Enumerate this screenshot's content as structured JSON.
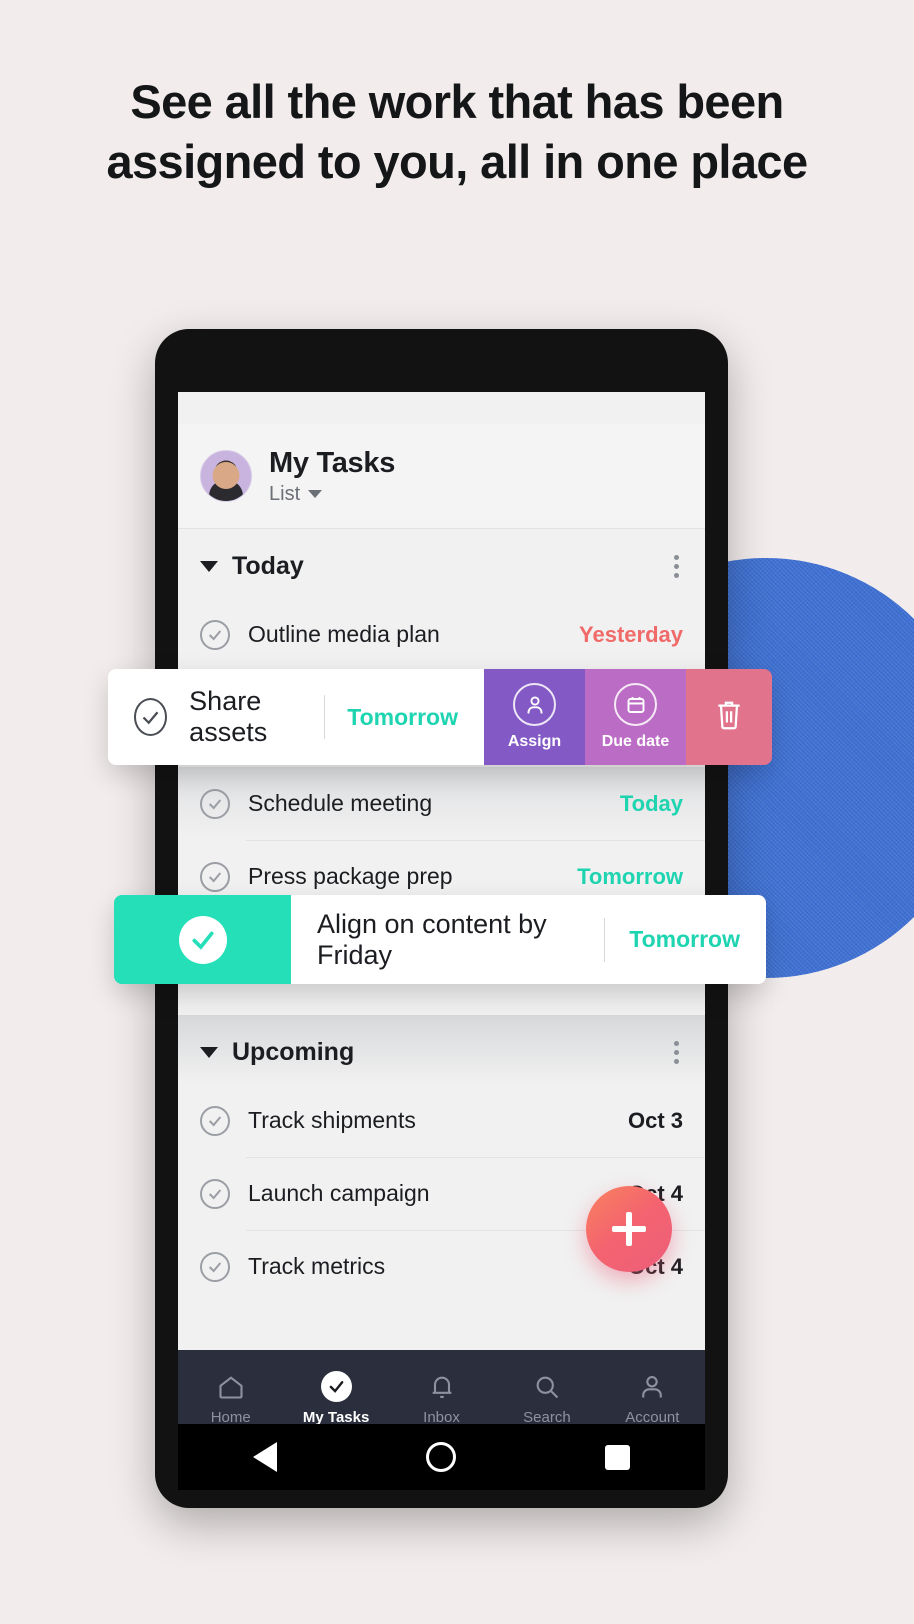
{
  "headline": {
    "line1": "See all the work that has been",
    "line2": "assigned to you, all in one place"
  },
  "colors": {
    "background": "#f2ecec",
    "blue_circle": "#3f71d4",
    "teal_accent": "#1fd4b0",
    "red_overdue": "#f06a6a",
    "fab": "#f4636f",
    "nav_bar": "#2b2f3d",
    "assign_action": "#8359c6",
    "duedate_action": "#bb6cc4",
    "delete_action": "#e1748c",
    "complete_swipe": "#24dfb7"
  },
  "phone": {
    "statusbar": {
      "icons": [
        "square-icon",
        "circle-icon",
        "triangle-down-icon"
      ]
    },
    "app_header": {
      "avatar": "user-avatar",
      "title": "My Tasks",
      "view_label": "List",
      "view_chevron": "chevron-down-icon"
    },
    "sections": [
      {
        "title": "Today",
        "collapse_icon": "triangle-down-icon",
        "menu_icon": "kebab-menu-icon",
        "tasks": [
          {
            "name": "Outline media plan",
            "due": "Yesterday",
            "due_style": "overdue"
          },
          {
            "name": "Schedule meeting",
            "due": "Today",
            "due_style": "today"
          },
          {
            "name": "Press package prep",
            "due": "Tomorrow",
            "due_style": "upcoming"
          }
        ]
      },
      {
        "title": "Upcoming",
        "collapse_icon": "triangle-down-icon",
        "menu_icon": "kebab-menu-icon",
        "tasks": [
          {
            "name": "Track shipments",
            "due": "Oct 3",
            "due_style": "dated"
          },
          {
            "name": "Launch campaign",
            "due": "Oct 4",
            "due_style": "dated"
          },
          {
            "name": "Track metrics",
            "due": "Oct 4",
            "due_style": "dated"
          }
        ]
      }
    ],
    "bottom_nav": [
      {
        "label": "Home",
        "icon": "home-icon",
        "active": false
      },
      {
        "label": "My Tasks",
        "icon": "check-circle-icon",
        "active": true
      },
      {
        "label": "Inbox",
        "icon": "bell-icon",
        "active": false
      },
      {
        "label": "Search",
        "icon": "search-icon",
        "active": false
      },
      {
        "label": "Account",
        "icon": "person-icon",
        "active": false
      }
    ],
    "system_bar": {
      "back": "back-triangle-icon",
      "home": "home-circle-icon",
      "recents": "recents-square-icon"
    },
    "fab": {
      "icon": "plus-icon",
      "label": "Add task"
    }
  },
  "swipe_card": {
    "check_icon": "check-circle-icon",
    "task_name": "Share assets",
    "due": "Tomorrow",
    "actions": [
      {
        "label": "Assign",
        "icon": "person-circle-icon"
      },
      {
        "label": "Due date",
        "icon": "calendar-icon"
      },
      {
        "label": "",
        "icon": "trash-icon"
      }
    ]
  },
  "complete_card": {
    "check_icon": "check-filled-icon",
    "task_name": "Align on content by Friday",
    "due": "Tomorrow"
  }
}
